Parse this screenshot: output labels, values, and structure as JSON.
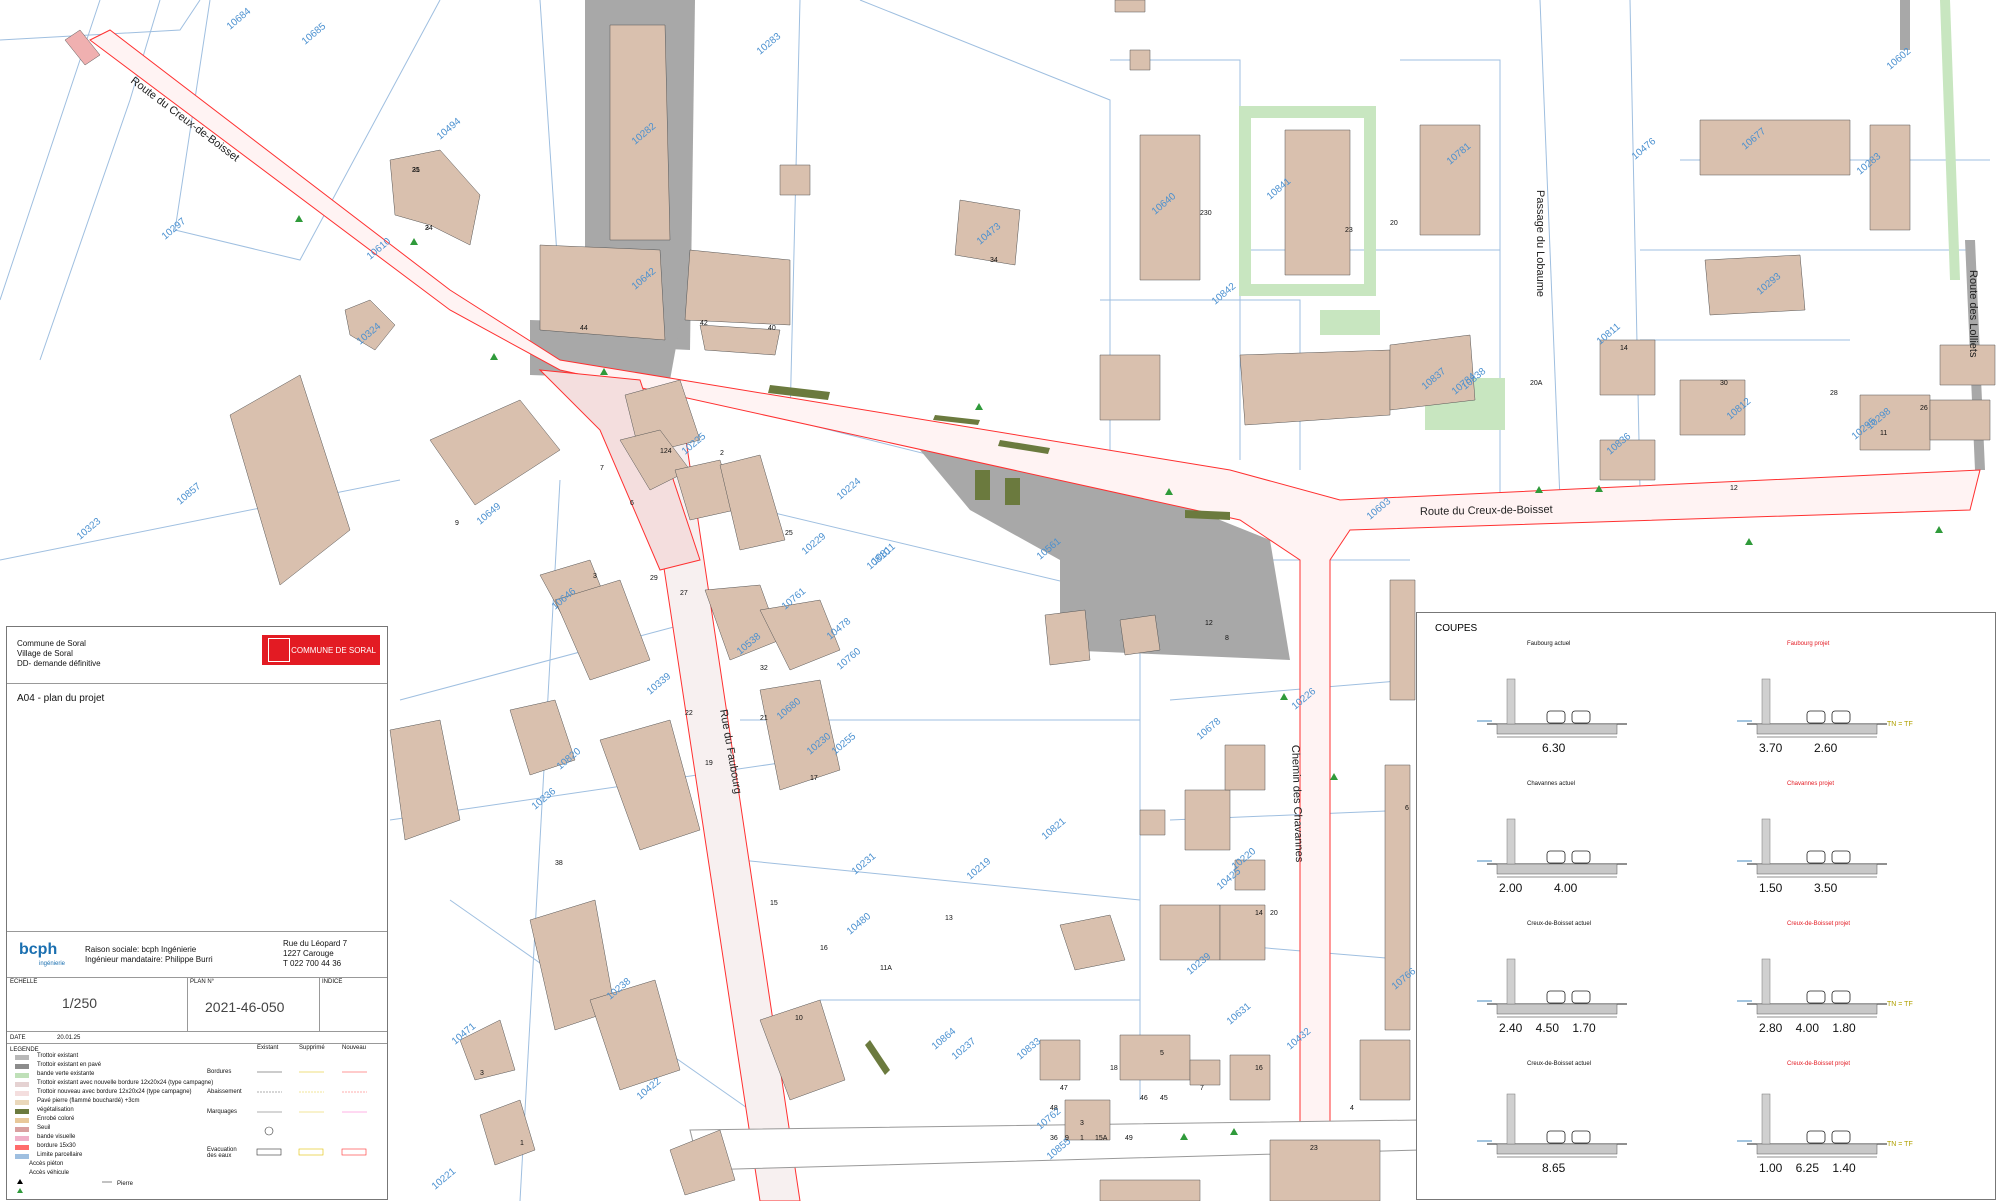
{
  "map": {
    "streets": [
      "Route du Creux-de-Boisset",
      "Route du Creux-de-Boisset",
      "Rue du Faubourg",
      "Chemin des Chavannes",
      "Passage du Lobaume",
      "Route des Lolliets"
    ],
    "parcels": [
      "10684",
      "10685",
      "10494",
      "10297",
      "10610",
      "10324",
      "10857",
      "10323",
      "10282",
      "10283",
      "10642",
      "10473",
      "10640",
      "10841",
      "10781",
      "10476",
      "10602",
      "10677",
      "10283",
      "10293",
      "10842",
      "10837",
      "10838",
      "10784",
      "10811",
      "10812",
      "10298",
      "10225",
      "10224",
      "10649",
      "10229",
      "10810",
      "10811",
      "10561",
      "10603",
      "10836",
      "10295",
      "10646",
      "10761",
      "10538",
      "10478",
      "10680",
      "10339",
      "10760",
      "10255",
      "10236",
      "10230",
      "10678",
      "10821",
      "10820",
      "10231",
      "10219",
      "10480",
      "10238",
      "10237",
      "10239",
      "10766",
      "10471",
      "10221",
      "10422",
      "10762",
      "10432",
      "10425",
      "10855",
      "10226",
      "10220",
      "10631",
      "10833",
      "10864"
    ],
    "building_numbers": [
      "35",
      "34",
      "44",
      "42",
      "40",
      "34",
      "230",
      "23",
      "20",
      "20A",
      "30",
      "28",
      "26",
      "14",
      "12",
      "11",
      "9",
      "7",
      "124",
      "6",
      "2",
      "3",
      "29",
      "27",
      "32",
      "25",
      "21",
      "22",
      "19",
      "17",
      "15",
      "16",
      "13",
      "11A",
      "10",
      "12",
      "8",
      "6",
      "14",
      "4",
      "20",
      "23",
      "5",
      "18",
      "16",
      "3",
      "1",
      "38",
      "36",
      "9",
      "1",
      "15A",
      "49",
      "48",
      "47",
      "46",
      "45",
      "3",
      "7",
      "21",
      "2"
    ]
  },
  "titleblock": {
    "client_line1": "Commune de Soral",
    "client_line2": "Village de Soral",
    "client_line3": "DD- demande définitive",
    "logo_text": "COMMUNE DE SORAL",
    "drawing_title": "A04 - plan du projet",
    "firm_logo": "bcph",
    "firm_logo_sub": "ingénierie",
    "firm_name": "Raison sociale: bcph Ingénierie",
    "engineer": "Ingénieur mandataire: Philippe Burri",
    "address1": "Rue du Léopard 7",
    "address2": "1227 Carouge",
    "phone": "T 022 700 44 36",
    "scale_label": "ECHELLE",
    "scale_value": "1/250",
    "plan_label": "PLAN N°",
    "plan_value": "2021-46-050",
    "index_label": "INDICE",
    "date_label": "DATE",
    "date_value": "20.01.25",
    "legend_label": "LEGENDE",
    "legend_items": [
      {
        "label": "Trottoir existant",
        "color": "#b8b8b8"
      },
      {
        "label": "Trottoir existant en pavé",
        "color": "#8c8c8c"
      },
      {
        "label": "bande verte existante",
        "color": "#bfe0b8"
      },
      {
        "label": "Trottoir existant avec nouvelle bordure 12x20x24 (type campagne)",
        "color": "#e5d2d2"
      },
      {
        "label": "Trottoir nouveau avec bordure 12x20x24 (type campagne)",
        "color": "#f4dede"
      },
      {
        "label": "Pavé pierre (flammé bouchardé) +3cm",
        "color": "#ead8bb"
      },
      {
        "label": "végétalisation",
        "color": "#6b7a3e"
      },
      {
        "label": "Enrobé coloré",
        "color": "#e8c89a"
      },
      {
        "label": "Seuil",
        "color": "#d9a0a0"
      },
      {
        "label": "bande visuelle",
        "color": "#f0b0c8"
      },
      {
        "label": "bordure 15x30",
        "color": "#ff6b6b"
      },
      {
        "label": "Limite parcellaire",
        "color": "#9fbfe0"
      },
      {
        "label": "Accès piéton",
        "color": "#000000"
      },
      {
        "label": "Accès véhicule",
        "color": "#2f9a3a"
      }
    ],
    "legend_col_heads": [
      "Existant",
      "Supprimé",
      "Nouveau"
    ],
    "legend_rows": [
      "Bordures",
      "Abaissement",
      "Marquages",
      "Evacuation des eaux"
    ],
    "legend_pierre": "Pierre"
  },
  "sections": {
    "title": "COUPES",
    "items": [
      {
        "title": "Faubourg actuel",
        "dims": [
          "6.30"
        ]
      },
      {
        "title": "Faubourg projet",
        "dims": [
          "3.70",
          "2.60"
        ],
        "tn": "TN = TF"
      },
      {
        "title": "Chavannes actuel",
        "dims": [
          "2.00",
          "4.00"
        ]
      },
      {
        "title": "Chavannes projet",
        "dims": [
          "1.50",
          "3.50"
        ]
      },
      {
        "title": "Creux-de-Boisset actuel",
        "dims": [
          "2.40",
          "4.50",
          "1.70"
        ]
      },
      {
        "title": "Creux-de-Boisset projet",
        "dims": [
          "2.80",
          "4.00",
          "1.80"
        ],
        "tn": "TN = TF"
      },
      {
        "title": "Creux-de-Boisset actuel",
        "dims": [
          "8.65"
        ]
      },
      {
        "title": "Creux-de-Boisset projet",
        "dims": [
          "1.00",
          "6.25",
          "1.40"
        ],
        "tn": "TN = TF"
      }
    ]
  },
  "colors": {
    "building": "#d9c0ae",
    "parcel_line": "#9fbfe0",
    "road_project": "#f4dede",
    "pavement": "#a8a8a8",
    "green_strip": "#c8e6c0",
    "vegetation": "#6b7a3e",
    "soral_red": "#e31b23",
    "project_line": "#ff3030"
  }
}
